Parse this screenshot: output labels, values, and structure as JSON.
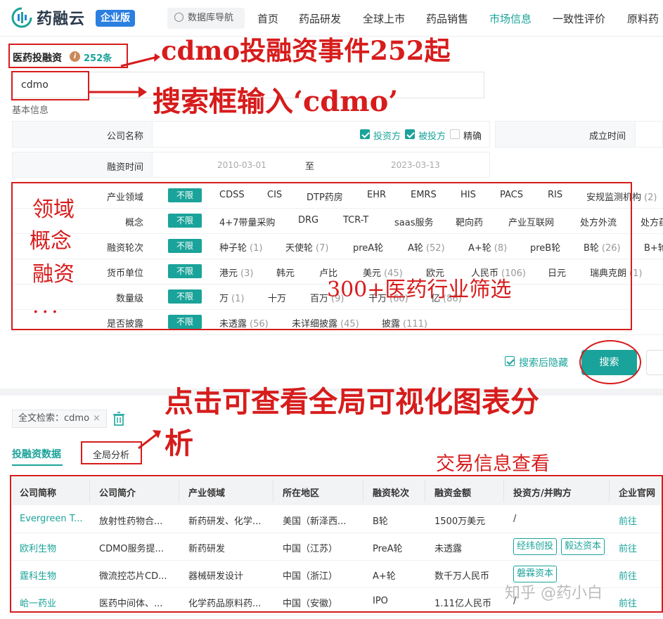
{
  "nav": {
    "logo_text": "药融云",
    "edition": "企业版",
    "db_nav": "数据库导航",
    "items": [
      "首页",
      "药品研发",
      "全球上市",
      "药品销售",
      "市场信息",
      "一致性评价",
      "原料药"
    ],
    "active_index": 4
  },
  "section": {
    "title": "医药投融资",
    "count": "252条"
  },
  "search": {
    "value": "cdmo"
  },
  "basic_info_label": "基本信息",
  "company_name": {
    "label": "公司名称",
    "checks": [
      {
        "label": "投资方",
        "checked": true
      },
      {
        "label": "被投方",
        "checked": true
      },
      {
        "label": "精确",
        "checked": false
      }
    ]
  },
  "established_label": "成立时间",
  "financing_time": {
    "label": "融资时间",
    "from": "2010-03-01",
    "to_label": "至",
    "to": "2023-03-13"
  },
  "filter_rows": [
    {
      "label": "产业领域",
      "all": "不限",
      "options": [
        {
          "t": "CDSS",
          "n": ""
        },
        {
          "t": "CIS",
          "n": ""
        },
        {
          "t": "DTP药房",
          "n": ""
        },
        {
          "t": "EHR",
          "n": ""
        },
        {
          "t": "EMRS",
          "n": ""
        },
        {
          "t": "HIS",
          "n": ""
        },
        {
          "t": "PACS",
          "n": ""
        },
        {
          "t": "RIS",
          "n": ""
        },
        {
          "t": "安规监测机构",
          "n": "(2)"
        }
      ]
    },
    {
      "label": "概念",
      "all": "不限",
      "options": [
        {
          "t": "4+7带量采购",
          "n": ""
        },
        {
          "t": "DRG",
          "n": ""
        },
        {
          "t": "TCR-T",
          "n": ""
        },
        {
          "t": "saas服务",
          "n": ""
        },
        {
          "t": "靶向药",
          "n": ""
        },
        {
          "t": "产业互联网",
          "n": ""
        },
        {
          "t": "处方外流",
          "n": ""
        },
        {
          "t": "处方药",
          "n": ""
        }
      ]
    },
    {
      "label": "融资轮次",
      "all": "不限",
      "options": [
        {
          "t": "种子轮",
          "n": "(1)"
        },
        {
          "t": "天使轮",
          "n": "(7)"
        },
        {
          "t": "preA轮",
          "n": ""
        },
        {
          "t": "A轮",
          "n": "(52)"
        },
        {
          "t": "A+轮",
          "n": "(8)"
        },
        {
          "t": "preB轮",
          "n": ""
        },
        {
          "t": "B轮",
          "n": "(26)"
        },
        {
          "t": "B+轮",
          "n": ""
        }
      ]
    },
    {
      "label": "货币单位",
      "all": "不限",
      "options": [
        {
          "t": "港元",
          "n": "(3)"
        },
        {
          "t": "韩元",
          "n": ""
        },
        {
          "t": "卢比",
          "n": ""
        },
        {
          "t": "美元",
          "n": "(45)"
        },
        {
          "t": "欧元",
          "n": ""
        },
        {
          "t": "人民币",
          "n": "(106)"
        },
        {
          "t": "日元",
          "n": ""
        },
        {
          "t": "瑞典克朗",
          "n": "(1)"
        }
      ]
    },
    {
      "label": "数量级",
      "all": "不限",
      "options": [
        {
          "t": "万",
          "n": "(1)"
        },
        {
          "t": "十万",
          "n": ""
        },
        {
          "t": "百万",
          "n": "(9)"
        },
        {
          "t": "千万",
          "n": "(60)"
        },
        {
          "t": "亿",
          "n": "(86)"
        }
      ]
    },
    {
      "label": "是否披露",
      "all": "不限",
      "options": [
        {
          "t": "未透露",
          "n": "(56)"
        },
        {
          "t": "未详细披露",
          "n": "(45)"
        },
        {
          "t": "披露",
          "n": "(111)"
        }
      ]
    }
  ],
  "hide_after_search": "搜索后隐藏",
  "search_button": "搜索",
  "chip": {
    "label": "全文检索：cdmo",
    "close": "×"
  },
  "tabs": [
    "投融资数据",
    "全局分析"
  ],
  "table": {
    "headers": [
      "公司简称",
      "公司简介",
      "产业领域",
      "所在地区",
      "融资轮次",
      "融资金额",
      "投资方/并购方",
      "企业官网"
    ],
    "rows": [
      {
        "name": "Evergreen T...",
        "intro": "放射性药物合...",
        "field": "新药研发、化学...",
        "region": "美国（新泽西...",
        "round": "B轮",
        "amount": "1500万美元",
        "investors": [],
        "investor_text": "/",
        "site": "前往"
      },
      {
        "name": "欧利生物",
        "intro": "CDMO服务提...",
        "field": "新药研发",
        "region": "中国（江苏）",
        "round": "PreA轮",
        "amount": "未透露",
        "investors": [
          "经纬创投",
          "毅达资本"
        ],
        "investor_text": "",
        "site": "前往"
      },
      {
        "name": "霆科生物",
        "intro": "微流控芯片CD...",
        "field": "器械研发设计",
        "region": "中国（浙江）",
        "round": "A+轮",
        "amount": "数千万人民币",
        "investors": [
          "磐霖资本"
        ],
        "investor_text": "",
        "site": "前往"
      },
      {
        "name": "峆一药业",
        "intro": "医药中间体、...",
        "field": "化学药品原料药...",
        "region": "中国（安徽）",
        "round": "IPO",
        "amount": "1.11亿人民币",
        "investors": [],
        "investor_text": "/",
        "site": "前往"
      }
    ]
  },
  "annotations": {
    "a1": "cdmo投融资事件252起",
    "a2": "搜索框输入‘cdmo’",
    "a3": "领域",
    "a4": "概念",
    "a5": "融资",
    "a6": "...",
    "a7": "300+医药行业筛选",
    "a8": "点击可查看全局可视化图表分",
    "a9": "析",
    "a10": "交易信息查看"
  },
  "watermark": "知乎 @药小白",
  "colors": {
    "accent": "#1aa39a",
    "annotation": "#d71c1c",
    "edition": "#2a7fe0"
  }
}
